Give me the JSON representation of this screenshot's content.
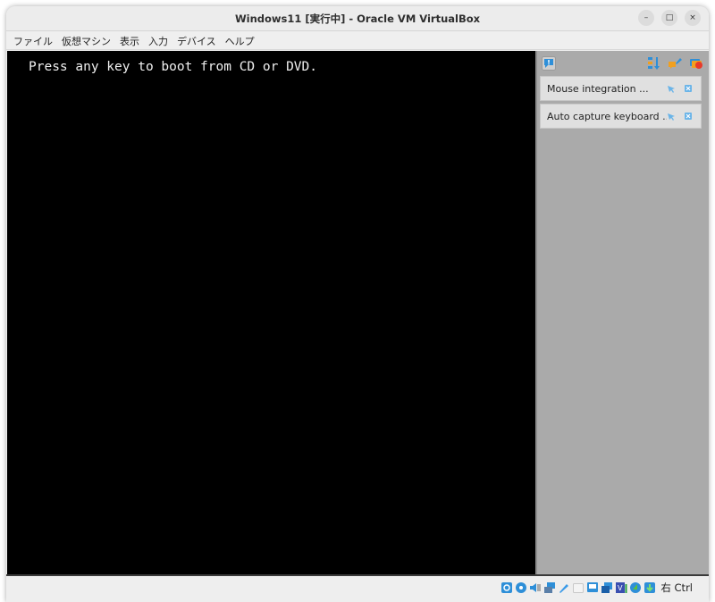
{
  "window": {
    "title": "Windows11 [実行中] - Oracle VM VirtualBox",
    "controls": {
      "minimize": "–",
      "maximize": "□",
      "close": "×"
    }
  },
  "menubar": {
    "items": [
      {
        "label": "ファイル"
      },
      {
        "label": "仮想マシン"
      },
      {
        "label": "表示"
      },
      {
        "label": "入力"
      },
      {
        "label": "デバイス"
      },
      {
        "label": "ヘルプ"
      }
    ]
  },
  "vm_screen": {
    "console_text": "Press any key to boot from CD or DVD."
  },
  "notification_pane": {
    "top_icons": [
      "notification-icon",
      "sort-icon",
      "edit-icon",
      "dismiss-all-icon"
    ],
    "notifications": [
      {
        "text": "Mouse integration ..."
      },
      {
        "text": "Auto capture keyboard ..."
      }
    ]
  },
  "statusbar": {
    "icons": [
      "hard-disk-icon",
      "optical-drive-icon",
      "audio-icon",
      "network-icon",
      "usb-icon",
      "shared-folders-icon",
      "display-icon",
      "recording-icon",
      "virtualization-icon",
      "cpu-activity-icon",
      "mouse-integration-icon",
      "keyboard-capture-icon"
    ],
    "host_key": "右 Ctrl"
  },
  "colors": {
    "vm_background": "#000000",
    "notification_pane": "#aaaaaa",
    "accent_blue": "#2e8fd8"
  }
}
